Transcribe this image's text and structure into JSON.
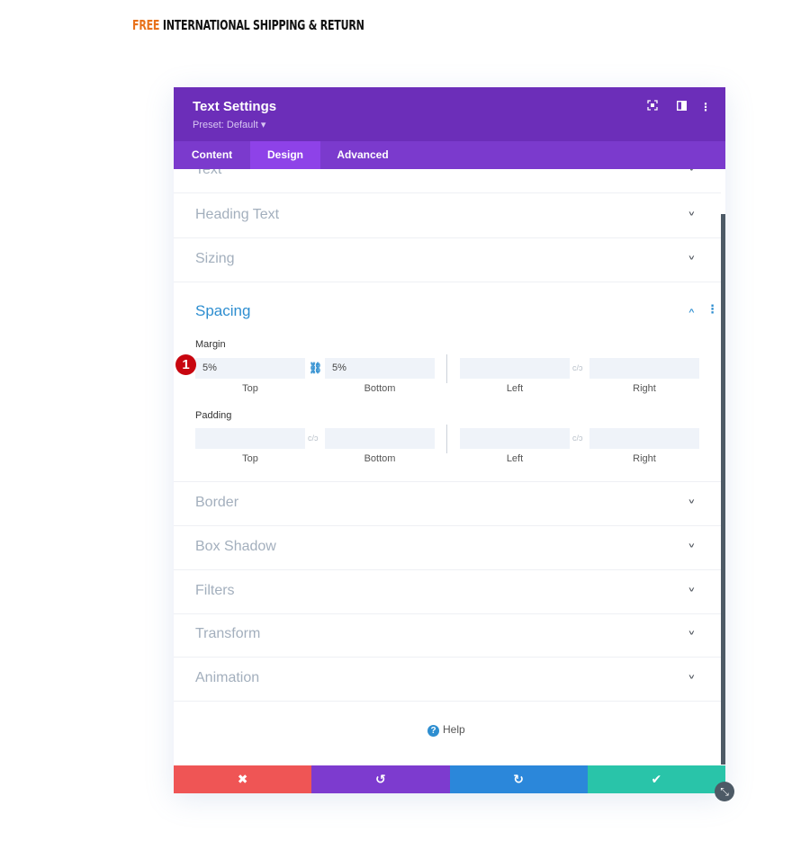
{
  "banner": {
    "highlight": "FREE",
    "text": " INTERNATIONAL SHIPPING & RETURN",
    "highlight_color": "#e8711b"
  },
  "modal": {
    "title": "Text Settings",
    "preset": "Preset: Default ▾",
    "header_icons": [
      "focus-icon",
      "split-view-icon",
      "more-vertical-icon"
    ],
    "tabs": [
      {
        "label": "Content"
      },
      {
        "label": "Design",
        "active": true
      },
      {
        "label": "Advanced"
      }
    ],
    "sections_top": [
      "Text",
      "Heading Text",
      "Sizing"
    ],
    "spacing": {
      "title": "Spacing",
      "margin": {
        "label": "Margin",
        "top": "5%",
        "bottom": "5%",
        "left": "",
        "right": "",
        "top_bottom_linked": true
      },
      "padding": {
        "label": "Padding",
        "top": "",
        "bottom": "",
        "left": "",
        "right": ""
      },
      "captions": {
        "top": "Top",
        "bottom": "Bottom",
        "left": "Left",
        "right": "Right"
      }
    },
    "sections_bottom": [
      "Border",
      "Box Shadow",
      "Filters",
      "Transform",
      "Animation"
    ],
    "help": "Help",
    "footer": {
      "cancel": "✖",
      "undo": "↺",
      "redo": "↻",
      "save": "✔",
      "colors": {
        "cancel": "#ef5555",
        "undo": "#7d3bcf",
        "redo": "#2b87da",
        "save": "#29c4a9"
      }
    }
  },
  "badge": "1",
  "colors": {
    "header": "#6c2eb9",
    "tabs": "#7b3acd",
    "active_tab": "#8e42e8",
    "accent": "#2e8ed0"
  }
}
